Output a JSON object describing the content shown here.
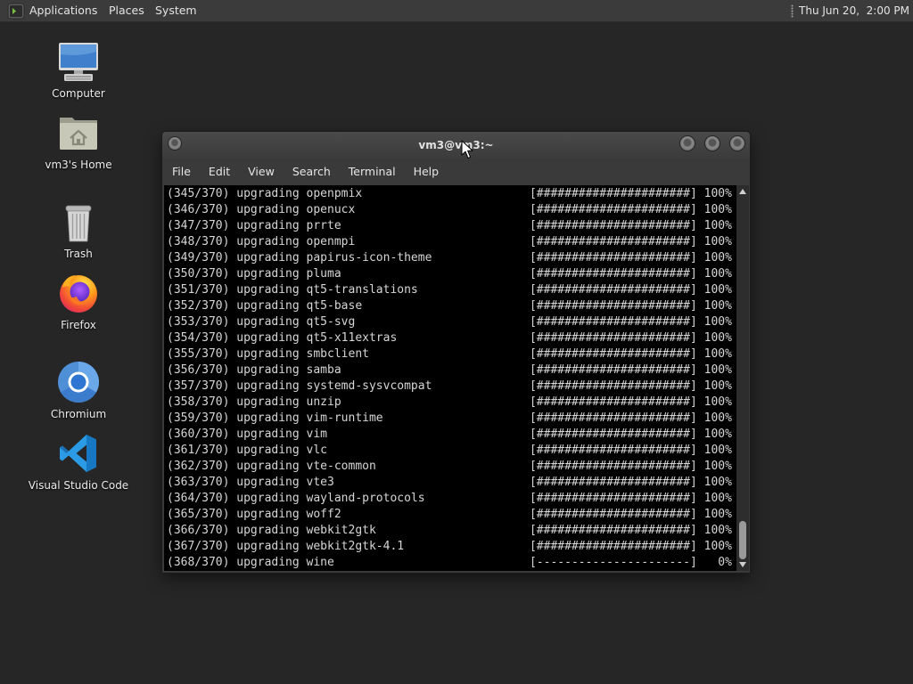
{
  "theme": {
    "desktop_background": "#262626",
    "panel_background": "#3b3b3b",
    "terminal_background": "#000000",
    "terminal_foreground": "#d6d6d6"
  },
  "top_panel": {
    "app_icon": "mate-menu-icon",
    "menus": [
      "Applications",
      "Places",
      "System"
    ],
    "clock": "Thu Jun 20,  2:00 PM"
  },
  "desktop": {
    "icons": [
      {
        "label": "Computer",
        "icon": "computer-icon"
      },
      {
        "label": "vm3's Home",
        "icon": "home-folder-icon"
      },
      {
        "label": "Trash",
        "icon": "trash-icon"
      },
      {
        "label": "Firefox",
        "icon": "firefox-icon"
      },
      {
        "label": "Chromium",
        "icon": "chromium-icon"
      },
      {
        "label": "Visual Studio Code",
        "icon": "vscode-icon"
      }
    ]
  },
  "terminal": {
    "title": "vm3@vm3:~",
    "menu": [
      "File",
      "Edit",
      "View",
      "Search",
      "Terminal",
      "Help"
    ],
    "lines": [
      {
        "message": "(345/370) upgrading openpmix",
        "bar": "[######################]",
        "percent": "100%"
      },
      {
        "message": "(346/370) upgrading openucx",
        "bar": "[######################]",
        "percent": "100%"
      },
      {
        "message": "(347/370) upgrading prrte",
        "bar": "[######################]",
        "percent": "100%"
      },
      {
        "message": "(348/370) upgrading openmpi",
        "bar": "[######################]",
        "percent": "100%"
      },
      {
        "message": "(349/370) upgrading papirus-icon-theme",
        "bar": "[######################]",
        "percent": "100%"
      },
      {
        "message": "(350/370) upgrading pluma",
        "bar": "[######################]",
        "percent": "100%"
      },
      {
        "message": "(351/370) upgrading qt5-translations",
        "bar": "[######################]",
        "percent": "100%"
      },
      {
        "message": "(352/370) upgrading qt5-base",
        "bar": "[######################]",
        "percent": "100%"
      },
      {
        "message": "(353/370) upgrading qt5-svg",
        "bar": "[######################]",
        "percent": "100%"
      },
      {
        "message": "(354/370) upgrading qt5-x11extras",
        "bar": "[######################]",
        "percent": "100%"
      },
      {
        "message": "(355/370) upgrading smbclient",
        "bar": "[######################]",
        "percent": "100%"
      },
      {
        "message": "(356/370) upgrading samba",
        "bar": "[######################]",
        "percent": "100%"
      },
      {
        "message": "(357/370) upgrading systemd-sysvcompat",
        "bar": "[######################]",
        "percent": "100%"
      },
      {
        "message": "(358/370) upgrading unzip",
        "bar": "[######################]",
        "percent": "100%"
      },
      {
        "message": "(359/370) upgrading vim-runtime",
        "bar": "[######################]",
        "percent": "100%"
      },
      {
        "message": "(360/370) upgrading vim",
        "bar": "[######################]",
        "percent": "100%"
      },
      {
        "message": "(361/370) upgrading vlc",
        "bar": "[######################]",
        "percent": "100%"
      },
      {
        "message": "(362/370) upgrading vte-common",
        "bar": "[######################]",
        "percent": "100%"
      },
      {
        "message": "(363/370) upgrading vte3",
        "bar": "[######################]",
        "percent": "100%"
      },
      {
        "message": "(364/370) upgrading wayland-protocols",
        "bar": "[######################]",
        "percent": "100%"
      },
      {
        "message": "(365/370) upgrading woff2",
        "bar": "[######################]",
        "percent": "100%"
      },
      {
        "message": "(366/370) upgrading webkit2gtk",
        "bar": "[######################]",
        "percent": "100%"
      },
      {
        "message": "(367/370) upgrading webkit2gtk-4.1",
        "bar": "[######################]",
        "percent": "100%"
      },
      {
        "message": "(368/370) upgrading wine",
        "bar": "[----------------------]",
        "percent": "0%"
      }
    ]
  }
}
